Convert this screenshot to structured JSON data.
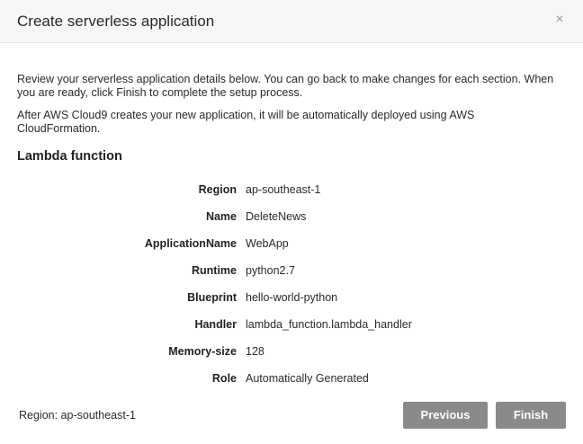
{
  "dialog": {
    "title": "Create serverless application",
    "close_glyph": "×"
  },
  "intro": {
    "review_text": "Review your serverless application details below. You can go back to make changes for each section. When you are ready, click Finish to complete the setup process.",
    "deploy_text": "After AWS Cloud9 creates your new application, it will be automatically deployed using AWS CloudFormation."
  },
  "lambda": {
    "section_title": "Lambda function",
    "details": [
      {
        "key": "Region",
        "value": "ap-southeast-1"
      },
      {
        "key": "Name",
        "value": "DeleteNews"
      },
      {
        "key": "ApplicationName",
        "value": "WebApp"
      },
      {
        "key": "Runtime",
        "value": "python2.7"
      },
      {
        "key": "Blueprint",
        "value": "hello-world-python"
      },
      {
        "key": "Handler",
        "value": "lambda_function.lambda_handler"
      },
      {
        "key": "Memory-size",
        "value": "128"
      },
      {
        "key": "Role",
        "value": "Automatically Generated"
      }
    ]
  },
  "footer": {
    "region_text": "Region: ap-southeast-1",
    "previous_label": "Previous",
    "finish_label": "Finish"
  },
  "icons": {
    "close": "close-icon"
  }
}
